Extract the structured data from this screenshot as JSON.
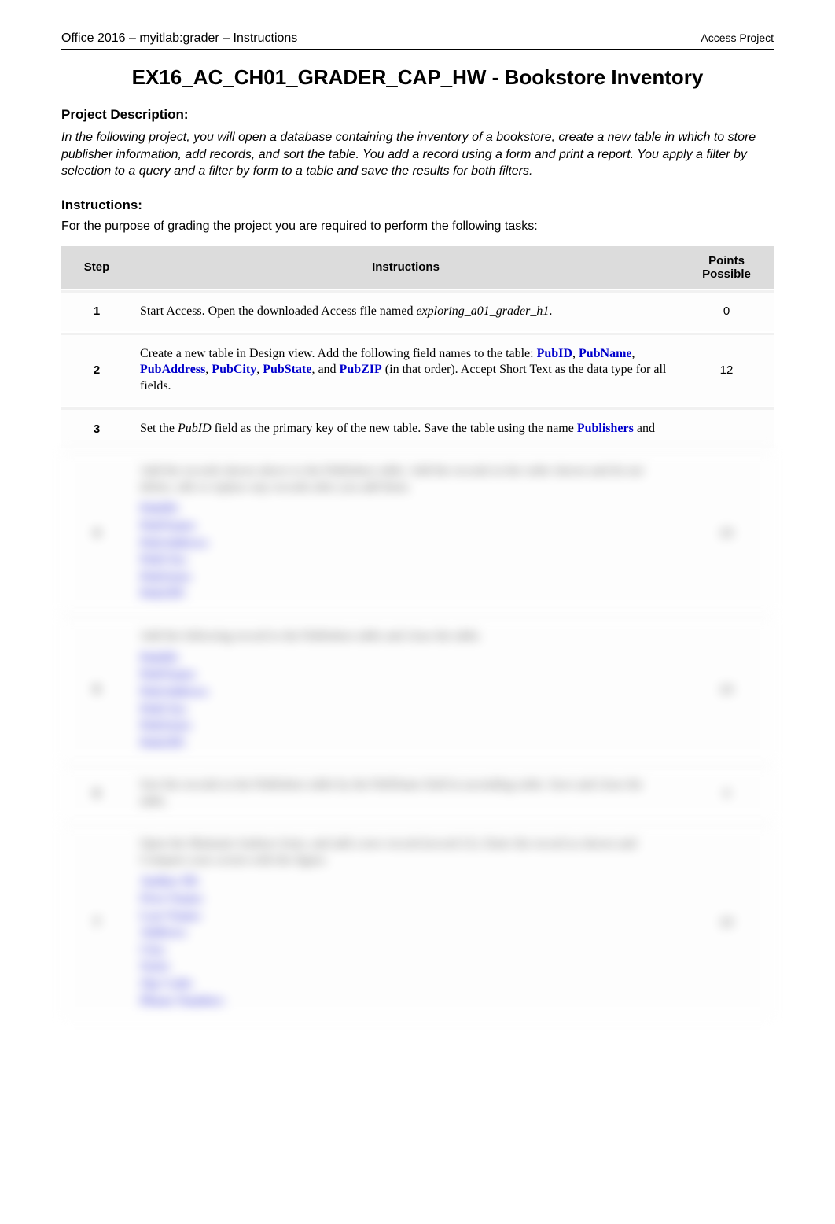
{
  "header": {
    "left": "Office 2016 – myitlab:grader – Instructions",
    "right": "Access Project"
  },
  "title": "EX16_AC_CH01_GRADER_CAP_HW - Bookstore Inventory",
  "sections": {
    "desc_heading": "Project Description:",
    "desc_text": "In the following project, you will open a database containing the inventory of a bookstore, create a new table in which to store publisher information, add records, and sort the table. You add a record using a form and print a report. You apply a filter by selection to a query and a filter by form to a table and save the results for both filters.",
    "instr_heading": "Instructions:",
    "instr_intro": "For the purpose of grading the project you are required to perform the following tasks:"
  },
  "table": {
    "headers": {
      "step": "Step",
      "instructions": "Instructions",
      "points": "Points Possible"
    },
    "rows": [
      {
        "step": "1",
        "plain_before": "Start Access. Open the downloaded Access file named ",
        "italic": "exploring_a01_grader_h1",
        "plain_after": ".",
        "points": "0"
      },
      {
        "step": "2",
        "html": "Create a new table in Design view. Add the following field names to the table: <span class='b'>PubID</span>, <span class='b'>PubName</span>, <span class='b'>PubAddress</span>, <span class='b'>PubCity</span>, <span class='b'>PubState</span>, and <span class='b'>PubZIP</span> (in that order). Accept Short Text as the data type for all fields.",
        "points": "12"
      },
      {
        "step": "3",
        "html": "Set the <span class='i'>PubID</span> field as the primary key of the new table. Save the table using the name <span class='b'>Publishers</span> and",
        "points": ""
      },
      {
        "step": "4",
        "html": "Add the records shown above to the Publishers table. Add the records in the order shown and do not delete, edit or replace any records after you add them.",
        "points": "10",
        "blur": true,
        "record": {
          "PubID": "",
          "PubName": "",
          "PubAddress": "",
          "PubCity": "",
          "PubState": "",
          "PubZIP": ""
        }
      },
      {
        "step": "5",
        "html": "Add the following record to the Publishers table and close the table.",
        "points": "10",
        "blur": true,
        "record": {
          "PubID": "",
          "PubName": "",
          "PubAddress": "",
          "PubCity": "",
          "PubState": "",
          "PubZIP": ""
        }
      },
      {
        "step": "6",
        "html": "Sort the records in the Publishers table by the PubName field in ascending order. Save and close the table.",
        "points": "4",
        "blur": true
      },
      {
        "step": "7",
        "html": "Open the Maintain Authors form, and add a new record (record 21). Enter the record as shown and Compare your screen with the figure.",
        "points": "10",
        "blur": true,
        "record": {
          "Author ID": "",
          "First Name": "",
          "Last Name": "",
          "Address": "",
          "City": "",
          "State": "",
          "Zip Code": "",
          "Phone Number": ""
        }
      }
    ]
  }
}
